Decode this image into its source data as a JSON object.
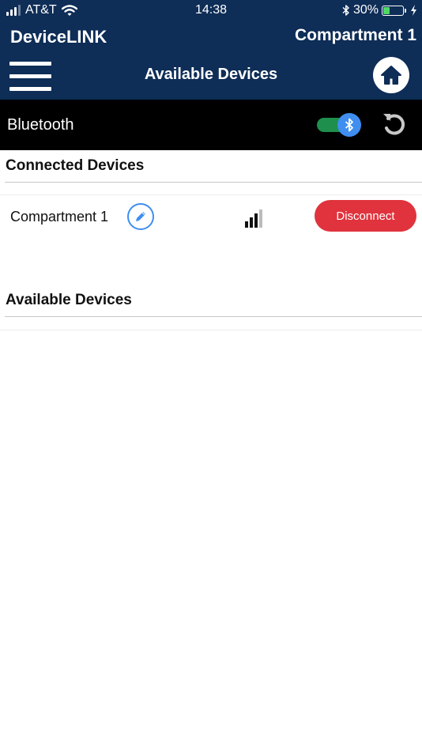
{
  "status_bar": {
    "carrier": "AT&T",
    "time": "14:38",
    "battery": "30%",
    "battery_level": 0.3
  },
  "header": {
    "app_title": "DeviceLINK",
    "device_title": "Compartment 1",
    "page_title": "Available Devices"
  },
  "bluetooth": {
    "label": "Bluetooth",
    "enabled": true
  },
  "connected_section": {
    "title": "Connected Devices",
    "devices": [
      {
        "name": "Compartment 1",
        "signal_bars": 3,
        "signal_max": 4,
        "action_label": "Disconnect"
      }
    ]
  },
  "available_section": {
    "title": "Available Devices"
  },
  "colors": {
    "header_bg": "#0e2d57",
    "bluetooth_bar_bg": "#000000",
    "toggle_track": "#1e8f4c",
    "accent_blue": "#3f8ef0",
    "disconnect_red": "#e0333d"
  },
  "icons": {
    "wifi": "wifi-icon",
    "bluetooth_status": "bluetooth-icon",
    "charging": "lightning-icon",
    "menu": "hamburger-menu-icon",
    "home": "home-icon",
    "refresh": "refresh-icon",
    "edit": "pencil-icon",
    "signal": "signal-strength-icon"
  }
}
